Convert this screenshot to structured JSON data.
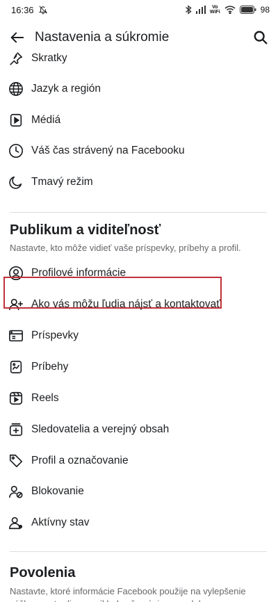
{
  "status_bar": {
    "time": "16:36",
    "volte_top": "Vo",
    "volte_bottom": "WiFi",
    "battery": "98"
  },
  "header": {
    "title": "Nastavenia a súkromie"
  },
  "preferences": {
    "items": [
      {
        "label": "Skratky",
        "icon": "pin-icon"
      },
      {
        "label": "Jazyk a región",
        "icon": "globe-icon"
      },
      {
        "label": "Médiá",
        "icon": "media-icon"
      },
      {
        "label": "Váš čas strávený na Facebooku",
        "icon": "clock-icon"
      },
      {
        "label": "Tmavý režim",
        "icon": "moon-icon"
      }
    ]
  },
  "audience": {
    "title": "Publikum a viditeľnosť",
    "subtitle": "Nastavte, kto môže vidieť vaše príspevky, príbehy a profil.",
    "items": [
      {
        "label": "Profilové informácie",
        "icon": "user-circle-icon"
      },
      {
        "label": "Ako vás môžu ľudia nájsť a kontaktovať",
        "icon": "user-add-icon"
      },
      {
        "label": "Príspevky",
        "icon": "posts-icon"
      },
      {
        "label": "Príbehy",
        "icon": "stories-icon"
      },
      {
        "label": "Reels",
        "icon": "reels-icon"
      },
      {
        "label": "Sledovatelia a verejný obsah",
        "icon": "followers-icon"
      },
      {
        "label": "Profil a označovanie",
        "icon": "tag-icon"
      },
      {
        "label": "Blokovanie",
        "icon": "block-user-icon"
      },
      {
        "label": "Aktívny stav",
        "icon": "active-status-icon"
      }
    ]
  },
  "permissions": {
    "title": "Povolenia",
    "subtitle": "Nastavte, ktoré informácie Facebook použije na vylepšenie vášho prostredia, napríklad vaše záujmy a polohu."
  },
  "colors": {
    "highlight": "#c0303a",
    "text": "#1c1e21",
    "secondary": "#65676b"
  }
}
